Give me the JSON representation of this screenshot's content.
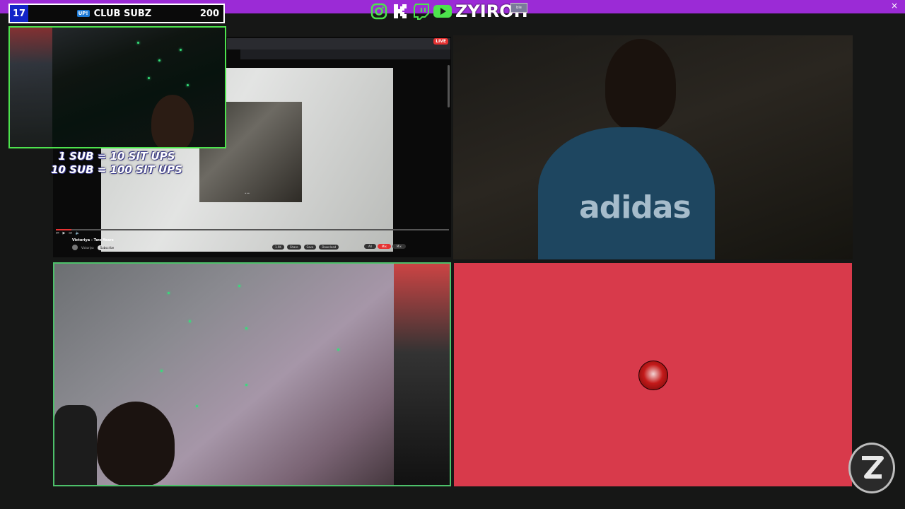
{
  "header": {
    "brand_name": "ZYIROH",
    "close_symbol": "×",
    "social_icons": [
      "instagram-icon",
      "kick-icon",
      "twitch-icon",
      "youtube-icon"
    ],
    "bar_color": "#9b2bd6"
  },
  "sub_goal": {
    "current_count": "17",
    "badge": "UP!",
    "title": "CLUB SUBZ",
    "goal": "200"
  },
  "challenge": {
    "line1": "1 SUB = 10 SIT UPS",
    "line2": "10 SUB = 100 SIT UPS"
  },
  "screen_share": {
    "live_badge": "LIVE",
    "video_title": "Victoriya - Two Years",
    "channel_name": "Victoriya",
    "subscribe_label": "Subscribe",
    "action_buttons": [
      "1.9K",
      "Share",
      "Save",
      "Download"
    ],
    "filter_pills": [
      "All",
      "Mix",
      "Mix"
    ],
    "progress_fraction": 0.04
  },
  "webcam_right": {
    "hoodie_text": "adidas"
  },
  "colors": {
    "accent": "#9b2bd6",
    "cam_border": "#4de34d",
    "red_panel": "#d83a4b"
  }
}
